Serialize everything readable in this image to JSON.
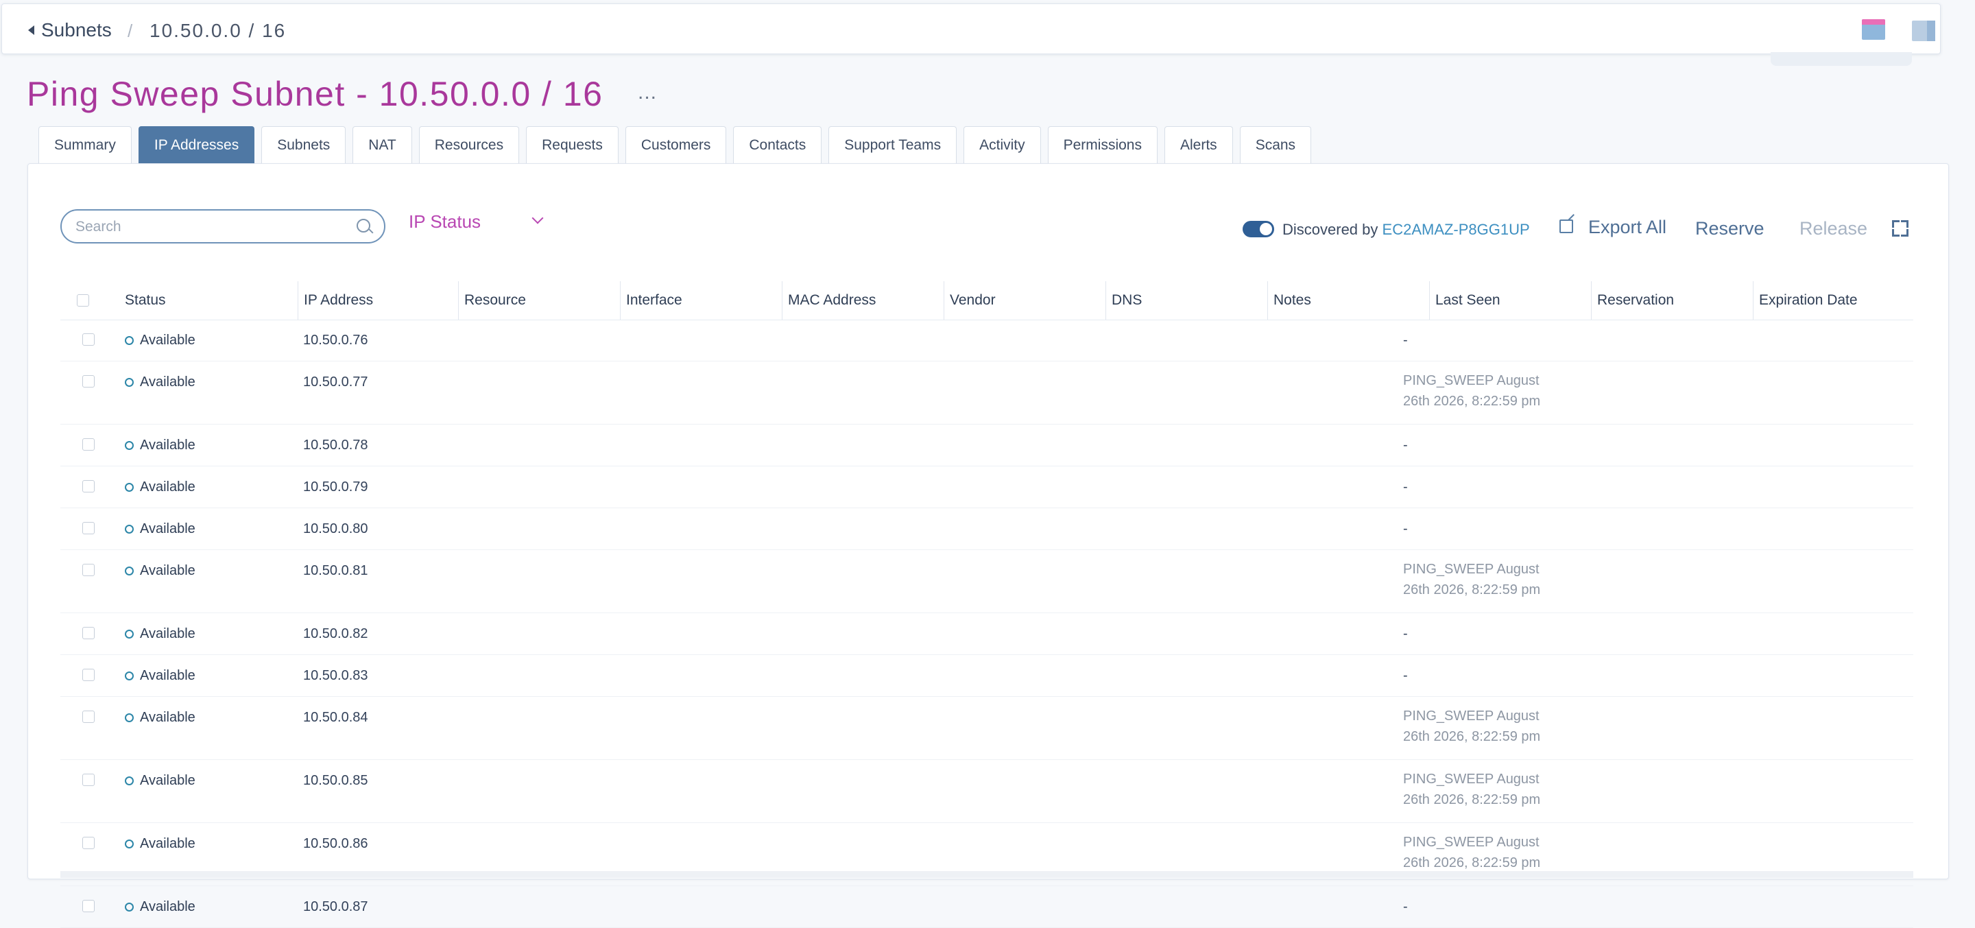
{
  "breadcrumb": {
    "back_label": "Subnets",
    "separator": "/",
    "current": "10.50.0.0 / 16"
  },
  "page": {
    "title": "Ping Sweep Subnet - 10.50.0.0 / 16",
    "more_label": "..."
  },
  "tabs": [
    {
      "label": "Summary",
      "active": false
    },
    {
      "label": "IP Addresses",
      "active": true
    },
    {
      "label": "Subnets",
      "active": false
    },
    {
      "label": "NAT",
      "active": false
    },
    {
      "label": "Resources",
      "active": false
    },
    {
      "label": "Requests",
      "active": false
    },
    {
      "label": "Customers",
      "active": false
    },
    {
      "label": "Contacts",
      "active": false
    },
    {
      "label": "Support Teams",
      "active": false
    },
    {
      "label": "Activity",
      "active": false
    },
    {
      "label": "Permissions",
      "active": false
    },
    {
      "label": "Alerts",
      "active": false
    },
    {
      "label": "Scans",
      "active": false
    }
  ],
  "toolbar": {
    "search_placeholder": "Search",
    "status_filter_label": "IP Status",
    "discovered_label": "Discovered by",
    "discovered_host": "EC2AMAZ-P8GG1UP",
    "discovered_toggle_on": true,
    "export_label": "Export All",
    "reserve_label": "Reserve",
    "release_label": "Release"
  },
  "table": {
    "columns": [
      "Status",
      "IP Address",
      "Resource",
      "Interface",
      "MAC Address",
      "Vendor",
      "DNS",
      "Notes",
      "Last Seen",
      "Reservation",
      "Expiration Date"
    ],
    "rows": [
      {
        "status": "Available",
        "ip": "10.50.0.76",
        "last_seen_1": "-",
        "last_seen_2": ""
      },
      {
        "status": "Available",
        "ip": "10.50.0.77",
        "last_seen_1": "PING_SWEEP August",
        "last_seen_2": "26th 2026, 8:22:59 pm"
      },
      {
        "status": "Available",
        "ip": "10.50.0.78",
        "last_seen_1": "-",
        "last_seen_2": ""
      },
      {
        "status": "Available",
        "ip": "10.50.0.79",
        "last_seen_1": "-",
        "last_seen_2": ""
      },
      {
        "status": "Available",
        "ip": "10.50.0.80",
        "last_seen_1": "-",
        "last_seen_2": ""
      },
      {
        "status": "Available",
        "ip": "10.50.0.81",
        "last_seen_1": "PING_SWEEP August",
        "last_seen_2": "26th 2026, 8:22:59 pm"
      },
      {
        "status": "Available",
        "ip": "10.50.0.82",
        "last_seen_1": "-",
        "last_seen_2": ""
      },
      {
        "status": "Available",
        "ip": "10.50.0.83",
        "last_seen_1": "-",
        "last_seen_2": ""
      },
      {
        "status": "Available",
        "ip": "10.50.0.84",
        "last_seen_1": "PING_SWEEP August",
        "last_seen_2": "26th 2026, 8:22:59 pm"
      },
      {
        "status": "Available",
        "ip": "10.50.0.85",
        "last_seen_1": "PING_SWEEP August",
        "last_seen_2": "26th 2026, 8:22:59 pm"
      },
      {
        "status": "Available",
        "ip": "10.50.0.86",
        "last_seen_1": "PING_SWEEP August",
        "last_seen_2": "26th 2026, 8:22:59 pm"
      },
      {
        "status": "Available",
        "ip": "10.50.0.87",
        "last_seen_1": "-",
        "last_seen_2": ""
      }
    ]
  },
  "colors": {
    "title": "#a9389b",
    "active_tab": "#4f78a4",
    "status_ring": "#2c86a8",
    "host_link": "#3d8fc1",
    "filter": "#b948b3"
  }
}
